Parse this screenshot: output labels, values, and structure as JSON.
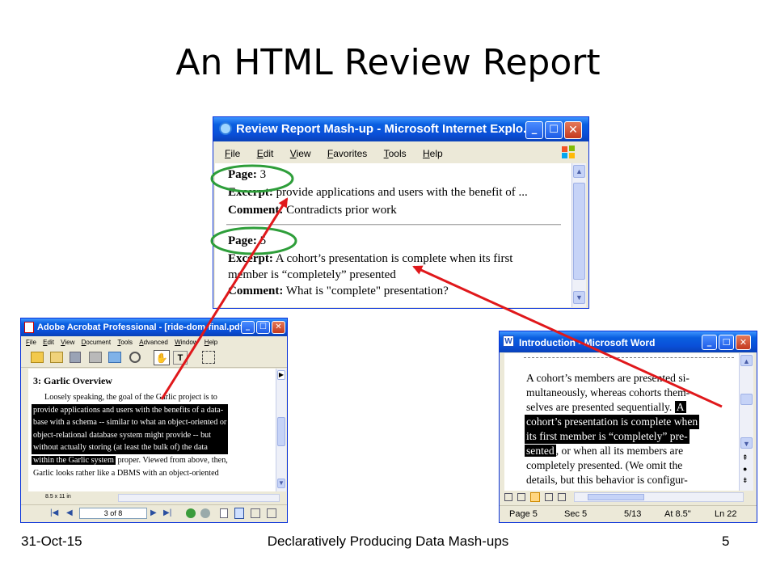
{
  "slide": {
    "title": "An HTML Review Report",
    "footer_date": "31-Oct-15",
    "footer_title": "Declaratively Producing Data Mash-ups",
    "footer_page": "5"
  },
  "ie": {
    "title": "Review Report Mash-up - Microsoft Internet Explo...",
    "menu": [
      "File",
      "Edit",
      "View",
      "Favorites",
      "Tools",
      "Help"
    ],
    "entries": [
      {
        "page_label": "Page:",
        "page_value": "3",
        "excerpt_label": "Excerpt:",
        "excerpt_value": "provide applications and users with the benefit of ...",
        "comment_label": "Comment:",
        "comment_value": "Contradicts prior work"
      },
      {
        "page_label": "Page:",
        "page_value": "5",
        "excerpt_label": "Excerpt:",
        "excerpt_value": "A cohort’s presentation is complete when its first",
        "excerpt_cont": "member is “completely” presented",
        "comment_label": "Comment:",
        "comment_value": "What is \"complete\" presentation?"
      }
    ]
  },
  "acrobat": {
    "title": "Adobe Acrobat Professional - [ride-dom-final.pdf]",
    "menu": [
      "File",
      "Edit",
      "View",
      "Document",
      "Tools",
      "Advanced",
      "Window",
      "Help"
    ],
    "heading": "3: Garlic Overview",
    "lines": [
      "Loosely speaking, the goal of the Garlic project is to",
      "provide applications and users with the benefits of a data-",
      "base with a schema -- similar to what an object-oriented or",
      "object-relational database system might provide -- but",
      "without actually storing (at least the bulk of) the data",
      "proper. Viewed from above, then,",
      "Garlic looks rather like a DBMS with an object-oriented"
    ],
    "highlight_tail": "within the Garlic system",
    "page_size": "8.5 x 11 in",
    "page_nav": "3 of 8"
  },
  "word": {
    "title": "Introduction - Microsoft Word",
    "lines": [
      "A cohort’s members are presented si-",
      "multaneously, whereas cohorts them-",
      "selves are presented sequentially.",
      "cohort’s presentation is complete when",
      "its first member is “completely” pre-",
      ", or when all its members are",
      "completely presented. (We omit the",
      "details, but this behavior is configur-"
    ],
    "hl_A": "A",
    "hl_sented": "sented",
    "status": {
      "page": "Page 5",
      "sec": "Sec 5",
      "pos": "5/13",
      "at": "At 8.5\"",
      "ln": "Ln 22"
    }
  },
  "colors": {
    "arrow": "#e0181b",
    "circle": "#2e9e3a",
    "xp_title": "#0a4fd8"
  }
}
